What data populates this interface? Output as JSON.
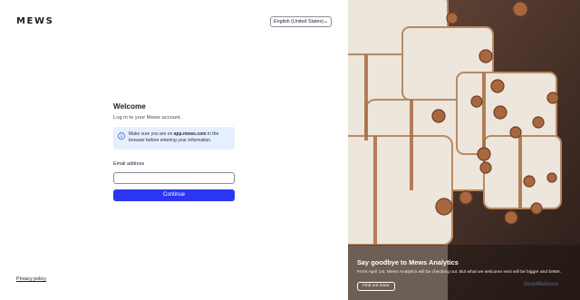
{
  "header": {
    "logo": "MEWS",
    "language": "English (United States)"
  },
  "login": {
    "title": "Welcome",
    "subtitle": "Log in to your Mews account.",
    "info_prefix": "Make sure you are on ",
    "info_domain": "app.mews.com",
    "info_suffix": " in the browser before entering your information.",
    "email_label": "Email address",
    "email_value": "",
    "email_placeholder": "",
    "continue_label": "Continue"
  },
  "footer": {
    "privacy_label": "Privacy policy"
  },
  "promo": {
    "title": "Say goodbye to Mews Analytics",
    "body": "From April 1st, Mews Analytics will be checking out. But what we welcome next will be bigger and better.",
    "button_label": "Find out more",
    "watermark": "ScanMalware"
  },
  "colors": {
    "accent": "#2b35f2",
    "info_bg": "#e6efff",
    "text": "#1c1d2b"
  }
}
